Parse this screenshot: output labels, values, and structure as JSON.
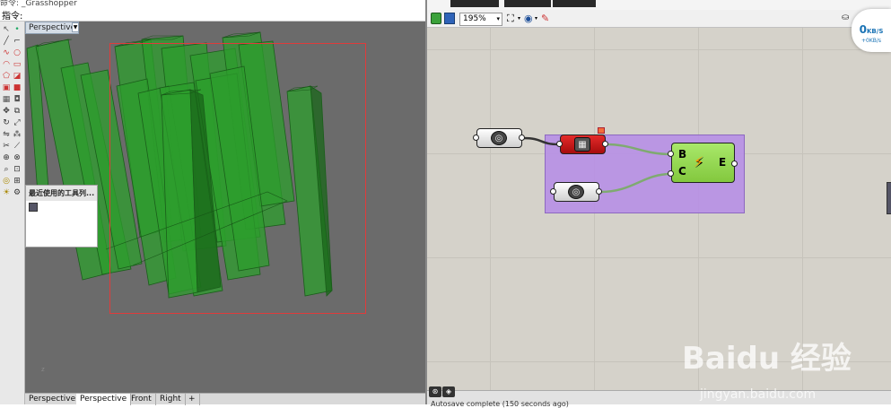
{
  "rhino": {
    "cmd_top_text": "命令: _Grasshopper",
    "cmd_label": "指令:",
    "viewport_title": "Perspective",
    "viewport_tabs": [
      "Perspective",
      "Perspective",
      "Front",
      "Right"
    ],
    "add_tab_glyph": "+",
    "recent_panel_title": "最近使用的工具列...",
    "selection_color": "#e03b3b",
    "box_color": "#2c9e2c"
  },
  "gh": {
    "zoom_value": "195%",
    "status_text": "Autosave complete (150 seconds ago)",
    "components": {
      "merge": {
        "inputs": [
          "B",
          "C"
        ],
        "output": "E"
      }
    },
    "group_color": "#b78fe6",
    "component_color_ok": "#98db52",
    "component_color_error": "#d81b1b"
  },
  "net_badge": {
    "down": "0",
    "down_unit": "KB/S",
    "up": "+0KB/s"
  },
  "watermark": {
    "logo": "Baidu 经验",
    "url": "jingyan.baidu.com"
  }
}
